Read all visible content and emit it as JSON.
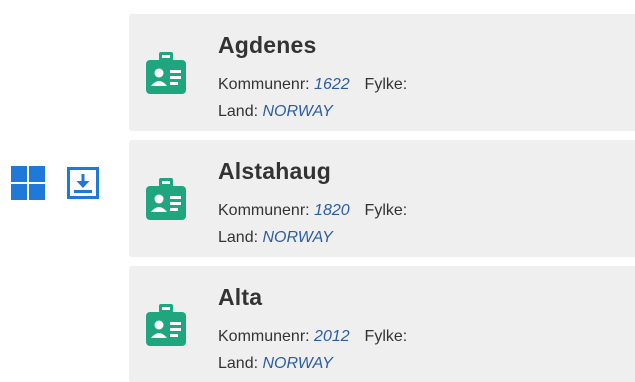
{
  "toolbar": {
    "grid_view_icon": "grid-icon",
    "download_icon": "download-icon",
    "accent_color": "#1e79d8"
  },
  "labels": {
    "kommunenr": "Kommunenr:",
    "fylke": "Fylke:",
    "land": "Land:"
  },
  "icon_color": "#1fa67f",
  "cards": [
    {
      "name": "Agdenes",
      "kommunenr": "1622",
      "fylke": "",
      "land": "NORWAY"
    },
    {
      "name": "Alstahaug",
      "kommunenr": "1820",
      "fylke": "",
      "land": "NORWAY"
    },
    {
      "name": "Alta",
      "kommunenr": "2012",
      "fylke": "",
      "land": "NORWAY"
    }
  ]
}
